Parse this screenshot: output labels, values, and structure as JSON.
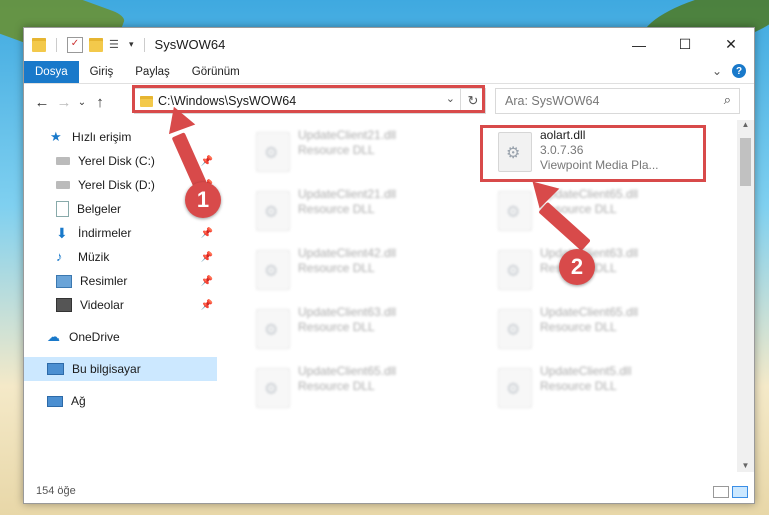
{
  "window": {
    "title": "SysWOW64",
    "controls": {
      "minimize": "—",
      "maximize": "☐",
      "close": "✕"
    }
  },
  "ribbon": {
    "tabs": [
      "Dosya",
      "Giriş",
      "Paylaş",
      "Görünüm"
    ],
    "collapse": "⌄",
    "help": "?"
  },
  "nav": {
    "back": "←",
    "forward": "→",
    "recent": "⌄",
    "up": "↑",
    "address": "C:\\Windows\\SysWOW64",
    "search_placeholder": "Ara: SysWOW64"
  },
  "sidebar": {
    "items": [
      {
        "label": "Hızlı erişim",
        "icon": "star-icon",
        "pin": false
      },
      {
        "label": "Yerel Disk (C:)",
        "icon": "drive-icon",
        "pin": true
      },
      {
        "label": "Yerel Disk (D:)",
        "icon": "drive-icon",
        "pin": true
      },
      {
        "label": "Belgeler",
        "icon": "documents-icon",
        "pin": true
      },
      {
        "label": "İndirmeler",
        "icon": "download-icon",
        "pin": true
      },
      {
        "label": "Müzik",
        "icon": "music-icon",
        "pin": true
      },
      {
        "label": "Resimler",
        "icon": "pictures-icon",
        "pin": true
      },
      {
        "label": "Videolar",
        "icon": "videos-icon",
        "pin": true
      },
      {
        "label": "OneDrive",
        "icon": "cloud-icon",
        "pin": false
      },
      {
        "label": "Bu bilgisayar",
        "icon": "computer-icon",
        "pin": false,
        "selected": true
      },
      {
        "label": "Ağ",
        "icon": "network-icon",
        "pin": false
      }
    ]
  },
  "files": {
    "highlighted": {
      "name": "aolart.dll",
      "version": "3.0.7.36",
      "description": "Viewpoint Media Pla..."
    },
    "blurred_left": [
      {
        "name": "UpdateClient21.dll",
        "type": "Resource DLL"
      },
      {
        "name": "UpdateClient21.dll",
        "type": "Resource DLL"
      },
      {
        "name": "UpdateClient42.dll",
        "type": "Resource DLL"
      },
      {
        "name": "UpdateClient63.dll",
        "type": "Resource DLL"
      },
      {
        "name": "UpdateClient65.dll",
        "type": "Resource DLL"
      }
    ],
    "blurred_right": [
      {
        "name": "UpdateClient65.dll",
        "type": "Resource DLL"
      },
      {
        "name": "UpdateClient63.dll",
        "type": "Resource DLL"
      },
      {
        "name": "UpdateClient65.dll",
        "type": "Resource DLL"
      },
      {
        "name": "UpdateClient5.dll",
        "type": "Resource DLL"
      }
    ]
  },
  "status": {
    "count": "154 öğe"
  },
  "annotations": {
    "step1": "1",
    "step2": "2"
  },
  "colors": {
    "accent": "#1979ca",
    "highlight": "#d84a4a",
    "selection": "#cce8ff"
  }
}
